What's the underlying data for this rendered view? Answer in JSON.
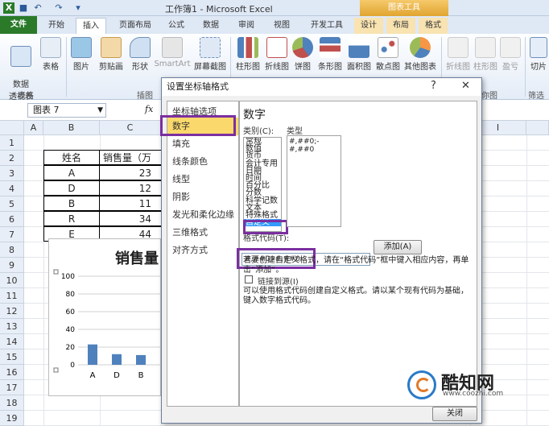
{
  "titlebar": {
    "document_title": "工作簿1 - Microsoft Excel",
    "context_tool_group": "图表工具"
  },
  "tabs": [
    {
      "label": "文件"
    },
    {
      "label": "开始"
    },
    {
      "label": "插入"
    },
    {
      "label": "页面布局"
    },
    {
      "label": "公式"
    },
    {
      "label": "数据"
    },
    {
      "label": "审阅"
    },
    {
      "label": "视图"
    },
    {
      "label": "开发工具"
    },
    {
      "label": "设计"
    },
    {
      "label": "布局"
    },
    {
      "label": "格式"
    }
  ],
  "ribbon": {
    "items": [
      {
        "label": "数据\n透视表",
        "icon": "pivot-table-icon"
      },
      {
        "label": "表格",
        "icon": "table-icon"
      },
      {
        "label": "图片",
        "icon": "picture-icon"
      },
      {
        "label": "剪贴画",
        "icon": "clipart-icon"
      },
      {
        "label": "形状",
        "icon": "shapes-icon"
      },
      {
        "label": "SmartArt",
        "icon": "smartart-icon"
      },
      {
        "label": "屏幕截图",
        "icon": "screenshot-icon"
      },
      {
        "label": "柱形图",
        "icon": "column-chart-icon"
      },
      {
        "label": "折线图",
        "icon": "line-chart-icon"
      },
      {
        "label": "饼图",
        "icon": "pie-chart-icon"
      },
      {
        "label": "条形图",
        "icon": "bar-chart-icon"
      },
      {
        "label": "面积图",
        "icon": "area-chart-icon"
      },
      {
        "label": "散点图",
        "icon": "scatter-chart-icon"
      },
      {
        "label": "其他图表",
        "icon": "other-chart-icon"
      },
      {
        "label": "折线图",
        "icon": "sparkline-line-icon"
      },
      {
        "label": "柱形图",
        "icon": "sparkline-column-icon"
      },
      {
        "label": "盈亏",
        "icon": "sparkline-winloss-icon"
      },
      {
        "label": "切片",
        "icon": "slicer-icon"
      }
    ],
    "groups": [
      "表格",
      "插图",
      "迷你图",
      "筛选"
    ]
  },
  "formula_bar": {
    "name_box": "图表 7",
    "fx": "fx"
  },
  "sheet": {
    "columns": [
      "A",
      "B",
      "C",
      "I"
    ],
    "rows": [
      "1",
      "2",
      "3",
      "4",
      "5",
      "6",
      "7",
      "8",
      "9",
      "10",
      "11",
      "12",
      "13",
      "14",
      "15",
      "16",
      "17",
      "18",
      "19"
    ],
    "table": {
      "headers": [
        "姓名",
        "销售量（万"
      ],
      "rows": [
        [
          "A",
          "23"
        ],
        [
          "D",
          "12"
        ],
        [
          "B",
          "11"
        ],
        [
          "R",
          "34"
        ],
        [
          "E",
          "44"
        ]
      ]
    }
  },
  "chart": {
    "title": "销售量",
    "y_ticks": [
      "100",
      "80",
      "60",
      "40",
      "20",
      "0"
    ],
    "x_labels": [
      "A",
      "D",
      "B"
    ]
  },
  "chart_data": {
    "type": "bar",
    "title": "销售量",
    "categories": [
      "A",
      "D",
      "B",
      "R",
      "E"
    ],
    "values": [
      23,
      12,
      11,
      34,
      44
    ],
    "ylim": [
      0,
      100
    ],
    "grid": true,
    "bar_color": "#4f81bd"
  },
  "dialog": {
    "title": "设置坐标轴格式",
    "help": "?",
    "close": "✕",
    "nav": [
      "坐标轴选项",
      "数字",
      "填充",
      "线条颜色",
      "线型",
      "阴影",
      "发光和柔化边缘",
      "三维格式",
      "对齐方式"
    ],
    "selected_nav": 1,
    "panel_title": "数字",
    "category_label": "类别(C):",
    "type_label": "类型",
    "categories": [
      "常规",
      "数值",
      "货币",
      "会计专用",
      "日期",
      "时间",
      "百分比",
      "分数",
      "科学记数",
      "文本",
      "特殊格式",
      "自定义"
    ],
    "selected_category": 11,
    "types": [
      "#,##0;-#,##0"
    ],
    "format_code_label": "格式代码(T):",
    "format_code_value": "#,##0;-#,##0",
    "add_button": "添加(A)",
    "hint": "若要创建自定义格式，请在“格式代码”框中键入相应内容，再单击“添加”。",
    "link_source_label": "链接到源(I)",
    "note": "可以使用格式代码创建自定义格式。请以某个现有代码为基础，键入数字格式代码。",
    "close_button": "关闭"
  },
  "watermark": {
    "brand": "酷知网",
    "url": "www.coozhi.com"
  }
}
